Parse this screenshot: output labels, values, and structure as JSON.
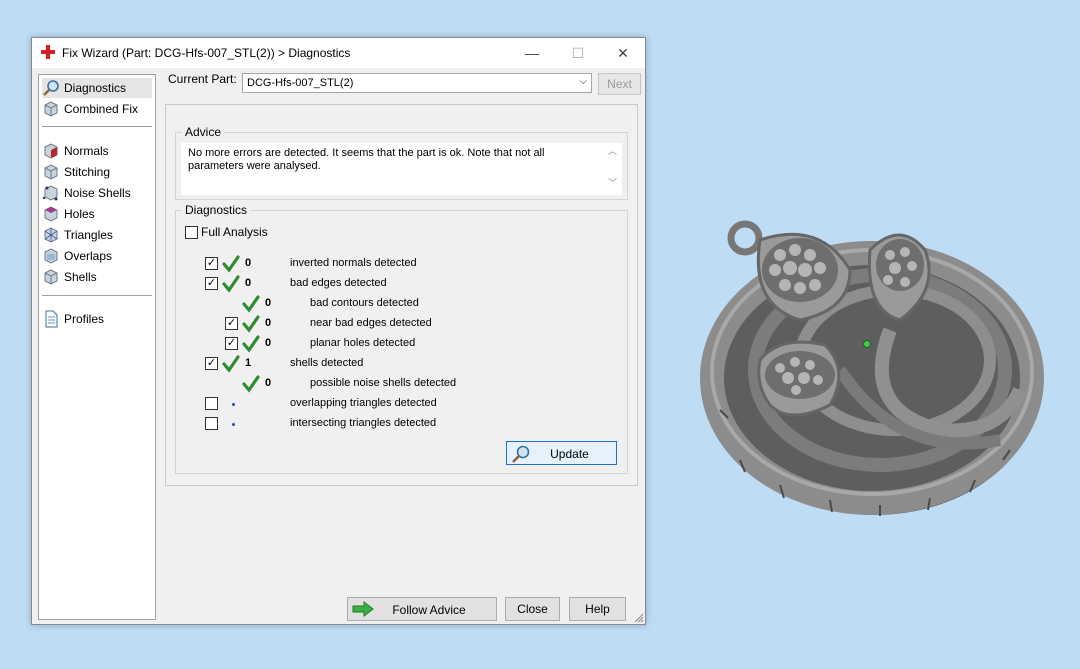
{
  "window": {
    "title": "Fix Wizard (Part: DCG-Hfs-007_STL(2)) > Diagnostics",
    "minimize_glyph": "—",
    "maximize_glyph": "☐",
    "close_glyph": "✕"
  },
  "sidebar": {
    "items": [
      {
        "label": "Diagnostics",
        "icon": "magnifier-icon"
      },
      {
        "label": "Combined Fix",
        "icon": "cube-icon"
      },
      {
        "label": "Normals",
        "icon": "normals-cube-icon"
      },
      {
        "label": "Stitching",
        "icon": "stitching-cube-icon"
      },
      {
        "label": "Noise Shells",
        "icon": "noise-shells-icon"
      },
      {
        "label": "Holes",
        "icon": "holes-cube-icon"
      },
      {
        "label": "Triangles",
        "icon": "triangles-icon"
      },
      {
        "label": "Overlaps",
        "icon": "overlaps-icon"
      },
      {
        "label": "Shells",
        "icon": "shells-icon"
      },
      {
        "label": "Profiles",
        "icon": "document-icon"
      }
    ],
    "selected": "Diagnostics"
  },
  "current_part": {
    "label": "Current Part:",
    "value": "DCG-Hfs-007_STL(2)"
  },
  "next_button": "Next",
  "advice": {
    "title": "Advice",
    "text": "No more errors are detected. It seems that the part is ok. Note that not all parameters were analysed."
  },
  "diagnostics": {
    "title": "Diagnostics",
    "full_analysis_label": "Full Analysis",
    "rows": [
      {
        "label": "inverted normals detected",
        "count": "0",
        "checked": true
      },
      {
        "label": "bad edges detected",
        "count": "0",
        "checked": true
      },
      {
        "label": "bad contours detected",
        "count": "0"
      },
      {
        "label": "near bad edges detected",
        "count": "0",
        "checked": true
      },
      {
        "label": "planar holes detected",
        "count": "0",
        "checked": true
      },
      {
        "label": "shells detected",
        "count": "1",
        "checked": true
      },
      {
        "label": "possible noise shells detected",
        "count": "0"
      },
      {
        "label": "overlapping triangles detected",
        "count": "",
        "checked": false
      },
      {
        "label": "intersecting triangles detected",
        "count": "",
        "checked": false
      }
    ],
    "update_button": "Update"
  },
  "footer": {
    "follow_advice": "Follow Advice",
    "close": "Close",
    "help": "Help"
  },
  "colors": {
    "background": "#bfdcf5",
    "check_green": "#2e8b2e",
    "model_gray": "#8a8a8a"
  }
}
